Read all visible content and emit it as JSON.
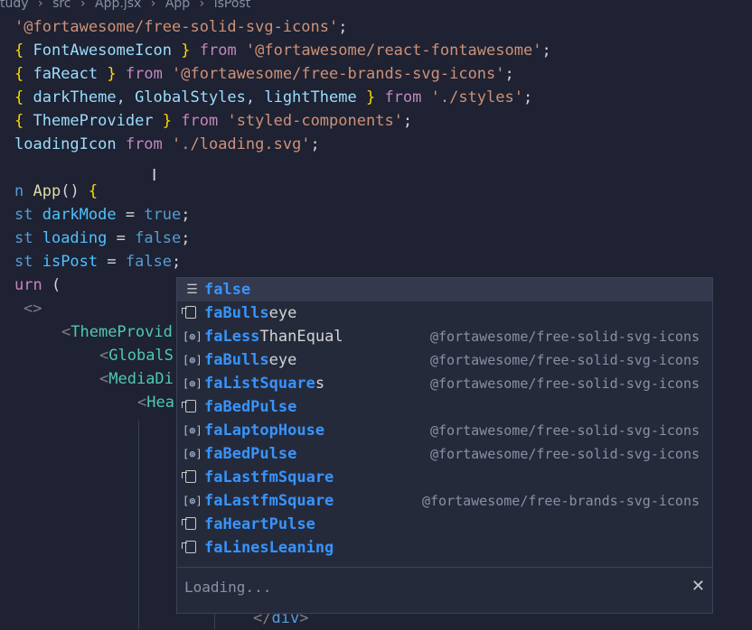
{
  "breadcrumb": [
    "tudy",
    "src",
    "App.jsx",
    "App",
    "isPost"
  ],
  "code": {
    "l1": {
      "str": "'@fortawesome/free-solid-svg-icons'",
      "end": ";"
    },
    "l2": {
      "ob": "{",
      "ids": " FontAwesomeIcon ",
      "cb": "}",
      "from": " from ",
      "str": "'@fortawesome/react-fontawesome'",
      "end": ";"
    },
    "l3": {
      "ob": "{",
      "ids": " faReact ",
      "cb": "}",
      "from": " from ",
      "str": "'@fortawesome/free-brands-svg-icons'",
      "end": ";"
    },
    "l4": {
      "ob": "{",
      "ids": " darkTheme, GlobalStyles, lightTheme ",
      "cb": "}",
      "from": " from ",
      "str": "'./styles'",
      "end": ";"
    },
    "l5": {
      "ob": "{",
      "ids": " ThemeProvider ",
      "cb": "}",
      "from": " from ",
      "str": "'styled-components'",
      "end": ";"
    },
    "l6": {
      "id": "loadingIcon",
      "from": " from ",
      "str": "'./loading.svg'",
      "end": ";"
    },
    "l7": {
      "kw": "n",
      "fn": " App",
      "paren": "() ",
      "ob": "{"
    },
    "l8": {
      "kw": "st",
      "var": " darkMode",
      "op": " = ",
      "val": "true",
      "end": ";"
    },
    "l9": {
      "kw": "st",
      "var": " loading",
      "op": " = ",
      "val": "false",
      "end": ";"
    },
    "l10": {
      "kw": "st",
      "var": " isPost",
      "op": " = ",
      "val": "false",
      "end": ";"
    },
    "l11": {
      "kw": "urn",
      "paren": " ("
    },
    "l12": {
      "frag": "<>"
    },
    "l13": {
      "lt": "<",
      "tag": "ThemeProvid"
    },
    "l14": {
      "lt": "<",
      "tag": "GlobalS"
    },
    "l15": {
      "lt": "<",
      "tag": "MediaDi"
    },
    "l16": {
      "lt": "<",
      "tag": "Hea"
    },
    "l17": {
      "lt": "</",
      "tag": "div",
      "gt": ">"
    }
  },
  "suggest": {
    "items": [
      {
        "icon": "keyword-icon",
        "label_match": "false",
        "label_rest": "",
        "detail": ""
      },
      {
        "icon": "snippet-icon",
        "label_match": "faBulls",
        "label_rest": "eye",
        "detail": ""
      },
      {
        "icon": "symbol-icon",
        "label_match": "faLess",
        "label_rest": "ThanEqual",
        "detail": "@fortawesome/free-solid-svg-icons"
      },
      {
        "icon": "symbol-icon",
        "label_match": "faBulls",
        "label_rest": "eye",
        "detail": "@fortawesome/free-solid-svg-icons"
      },
      {
        "icon": "symbol-icon",
        "label_match": "faListSquare",
        "label_rest": "s",
        "detail": "@fortawesome/free-solid-svg-icons"
      },
      {
        "icon": "snippet-icon",
        "label_match": "faBedPulse",
        "label_rest": "",
        "detail": ""
      },
      {
        "icon": "symbol-icon",
        "label_match": "faLaptopHouse",
        "label_rest": "",
        "detail": "@fortawesome/free-solid-svg-icons"
      },
      {
        "icon": "symbol-icon",
        "label_match": "faBedPulse",
        "label_rest": "",
        "detail": "@fortawesome/free-solid-svg-icons"
      },
      {
        "icon": "snippet-icon",
        "label_match": "faLastfmSquare",
        "label_rest": "",
        "detail": ""
      },
      {
        "icon": "symbol-icon",
        "label_match": "faLastfmSquare",
        "label_rest": "",
        "detail": "@fortawesome/free-brands-svg-icons"
      },
      {
        "icon": "snippet-icon",
        "label_match": "faHeartPulse",
        "label_rest": "",
        "detail": ""
      },
      {
        "icon": "snippet-icon",
        "label_match": "faLinesLeaning",
        "label_rest": "",
        "detail": ""
      }
    ],
    "status": "Loading...",
    "close_glyph": "✕"
  }
}
